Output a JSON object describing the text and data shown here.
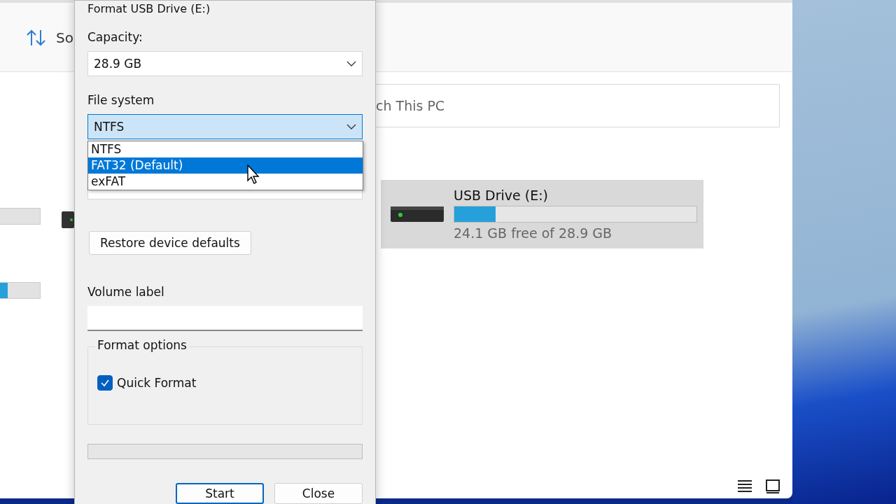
{
  "explorer": {
    "toolbar": {
      "sort_label": "So"
    },
    "search": {
      "placeholder": "ch This PC"
    },
    "partial_drives": [
      {
        "level": 0
      },
      {
        "level": 0.2
      }
    ],
    "drives": [
      {
        "name": "USB Drive (E:)",
        "level": 0.17,
        "free_text": "24.1 GB free of 28.9 GB",
        "selected": true
      }
    ]
  },
  "dialog": {
    "title": "Format USB Drive (E:)",
    "capacity": {
      "label": "Capacity:",
      "value": "28.9 GB"
    },
    "file_system": {
      "label": "File system",
      "value": "NTFS",
      "expanded": true,
      "options": [
        {
          "label": "NTFS",
          "highlighted": false
        },
        {
          "label": "FAT32 (Default)",
          "highlighted": true
        },
        {
          "label": "exFAT",
          "highlighted": false
        }
      ]
    },
    "restore_button": "Restore device defaults",
    "volume_label": {
      "label": "Volume label"
    },
    "format_options": {
      "legend": "Format options",
      "quick_format": {
        "label": "Quick Format",
        "checked": true
      }
    },
    "progress": {
      "level": 0
    },
    "buttons": [
      {
        "label": "Start",
        "default": true
      },
      {
        "label": "Close",
        "default": false
      }
    ]
  }
}
